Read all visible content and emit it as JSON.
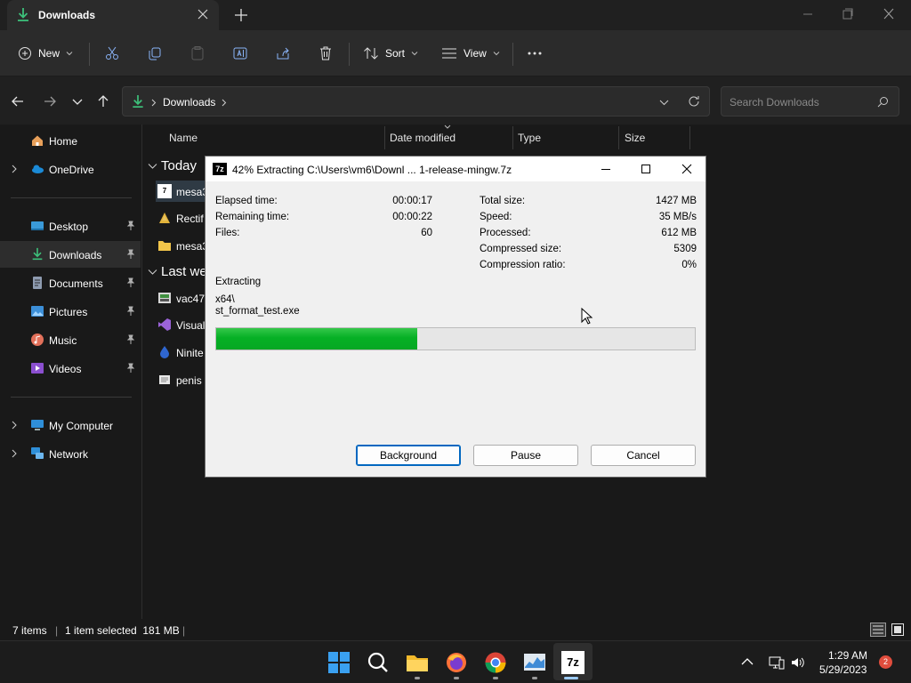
{
  "explorer": {
    "tab_title": "Downloads",
    "toolbar": {
      "new_label": "New",
      "sort_label": "Sort",
      "view_label": "View"
    },
    "address": {
      "crumb": "Downloads",
      "search_placeholder": "Search Downloads"
    },
    "sidebar": {
      "items": [
        {
          "label": "Home",
          "icon": "home-icon"
        },
        {
          "label": "OneDrive",
          "icon": "onedrive-icon"
        },
        {
          "label": "Desktop",
          "icon": "desktop-icon"
        },
        {
          "label": "Downloads",
          "icon": "downloads-icon"
        },
        {
          "label": "Documents",
          "icon": "documents-icon"
        },
        {
          "label": "Pictures",
          "icon": "pictures-icon"
        },
        {
          "label": "Music",
          "icon": "music-icon"
        },
        {
          "label": "Videos",
          "icon": "videos-icon"
        },
        {
          "label": "My Computer",
          "icon": "computer-icon"
        },
        {
          "label": "Network",
          "icon": "network-icon"
        }
      ]
    },
    "columns": [
      "Name",
      "Date modified",
      "Type",
      "Size"
    ],
    "groups": {
      "today": "Today",
      "last_week": "Last we"
    },
    "files": [
      {
        "name": "mesa3",
        "icon": "7zip-archive-icon"
      },
      {
        "name": "Rectif",
        "icon": "rectify-app-icon"
      },
      {
        "name": "mesa3",
        "icon": "folder-icon"
      },
      {
        "name": "vac47",
        "icon": "installer-icon"
      },
      {
        "name": "Visual",
        "icon": "visual-studio-icon"
      },
      {
        "name": "Ninite",
        "icon": "ninite-icon"
      },
      {
        "name": "penis",
        "icon": "text-file-icon"
      }
    ],
    "status": {
      "items": "7 items",
      "selected": "1 item selected  181 MB"
    }
  },
  "dialog": {
    "title": "42% Extracting C:\\Users\\vm6\\Downl ... 1-release-mingw.7z",
    "app_icon_text": "7z",
    "left_stats": [
      {
        "label": "Elapsed time:",
        "value": "00:00:17"
      },
      {
        "label": "Remaining time:",
        "value": "00:00:22"
      },
      {
        "label": "Files:",
        "value": "60"
      }
    ],
    "right_stats": [
      {
        "label": "Total size:",
        "value": "1427 MB"
      },
      {
        "label": "Speed:",
        "value": "35 MB/s"
      },
      {
        "label": "Processed:",
        "value": "612 MB"
      },
      {
        "label": "Compressed size:",
        "value": "5309"
      },
      {
        "label": "Compression ratio:",
        "value": "0%"
      }
    ],
    "operation": "Extracting",
    "current_path": "x64\\",
    "current_file": "st_format_test.exe",
    "progress_percent": 42,
    "buttons": {
      "background": "Background",
      "pause": "Pause",
      "cancel": "Cancel"
    }
  },
  "taskbar": {
    "time": "1:29 AM",
    "date": "5/29/2023",
    "notification_count": "2",
    "apps": [
      "start-icon",
      "search-icon",
      "file-explorer-icon",
      "firefox-icon",
      "chrome-icon",
      "task-manager-icon",
      "7zip-icon"
    ]
  },
  "colors": {
    "progress_green": "#06b025",
    "selected_bg": "#2d2d2d",
    "accent": "#0067c0"
  }
}
